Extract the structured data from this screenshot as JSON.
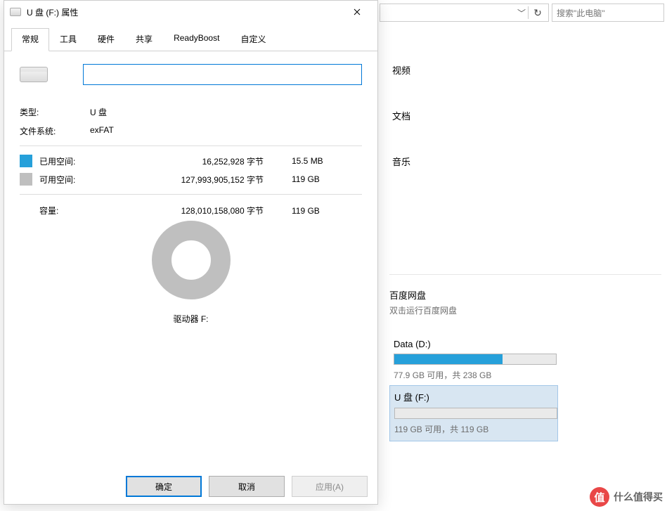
{
  "dialog": {
    "title": "U 盘 (F:) 属性",
    "tabs": [
      "常规",
      "工具",
      "硬件",
      "共享",
      "ReadyBoost",
      "自定义"
    ],
    "active_tab_index": 0,
    "name_value": "",
    "type_label": "类型:",
    "type_value": "U 盘",
    "fs_label": "文件系统:",
    "fs_value": "exFAT",
    "used": {
      "label": "已用空间:",
      "bytes": "16,252,928 字节",
      "human": "15.5 MB",
      "swatch": "#26a0da"
    },
    "free": {
      "label": "可用空间:",
      "bytes": "127,993,905,152 字节",
      "human": "119 GB",
      "swatch": "#bfbfbf"
    },
    "capacity": {
      "label": "容量:",
      "bytes": "128,010,158,080 字节",
      "human": "119 GB"
    },
    "drive_caption": "驱动器 F:",
    "buttons": {
      "ok": "确定",
      "cancel": "取消",
      "apply": "应用(A)"
    }
  },
  "explorer": {
    "search_placeholder": "搜索\"此电脑\"",
    "folders": [
      "视频",
      "文档",
      "音乐"
    ],
    "baidu": {
      "title": "百度网盘",
      "subtitle": "双击运行百度网盘"
    },
    "drives": [
      {
        "name": "Data (D:)",
        "sub": "77.9 GB 可用，共 238 GB",
        "fill_pct": 67
      },
      {
        "name": "U 盘 (F:)",
        "sub": "119 GB 可用，共 119 GB",
        "fill_pct": 0,
        "selected": true
      }
    ]
  },
  "watermark": {
    "badge": "值",
    "text": "什么值得买"
  }
}
